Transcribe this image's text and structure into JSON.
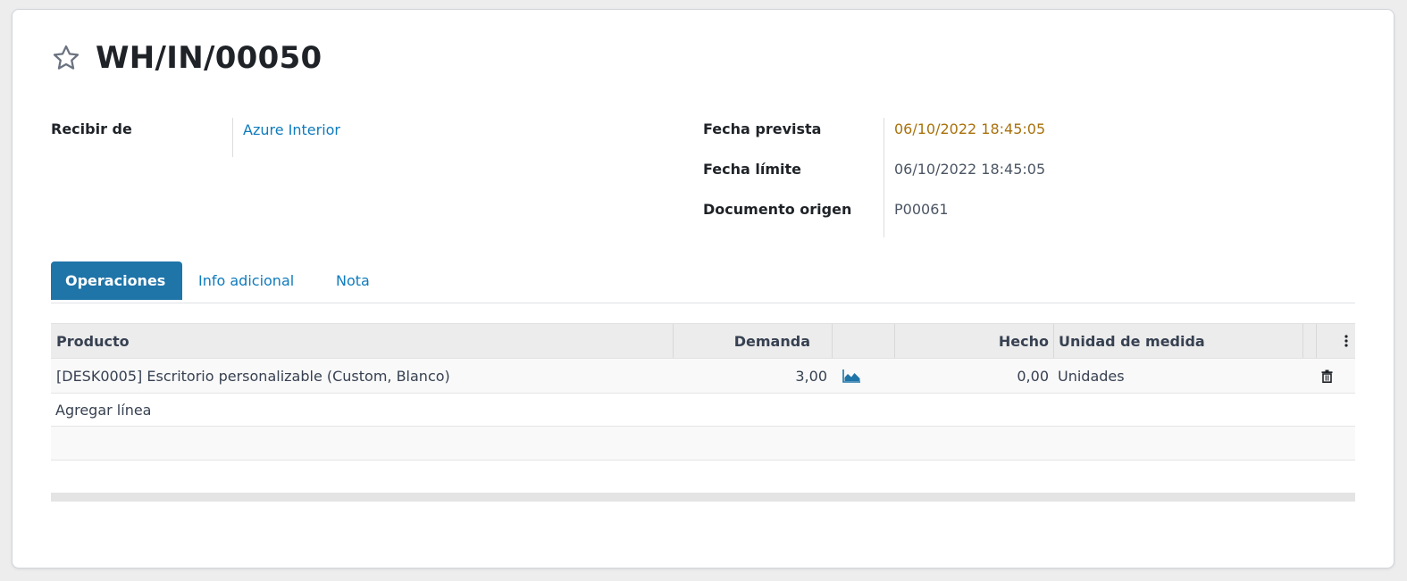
{
  "record": {
    "title": "WH/IN/00050"
  },
  "fields": {
    "receive_from_label": "Recibir de",
    "receive_from_value": "Azure Interior",
    "scheduled_date_label": "Fecha prevista",
    "scheduled_date_value": "06/10/2022 18:45:05",
    "deadline_label": "Fecha límite",
    "deadline_value": "06/10/2022 18:45:05",
    "source_doc_label": "Documento origen",
    "source_doc_value": "P00061"
  },
  "tabs": [
    {
      "label": "Operaciones",
      "active": true
    },
    {
      "label": "Info adicional",
      "active": false
    },
    {
      "label": "Nota",
      "active": false
    }
  ],
  "table": {
    "headers": {
      "product": "Producto",
      "demand": "Demanda",
      "done": "Hecho",
      "uom": "Unidad de medida"
    },
    "rows": [
      {
        "product": "[DESK0005] Escritorio personalizable (Custom, Blanco)",
        "demand": "3,00",
        "done": "0,00",
        "uom": "Unidades"
      }
    ],
    "add_line_label": "Agregar línea"
  },
  "colors": {
    "accent": "#1f74a8",
    "link": "#0f7bbd",
    "scheduled_date": "#a8720d"
  },
  "icons": {
    "favorite": "star-outline-icon",
    "forecast": "area-chart-icon",
    "delete": "trash-icon",
    "optional_columns": "vertical-dots-icon"
  }
}
